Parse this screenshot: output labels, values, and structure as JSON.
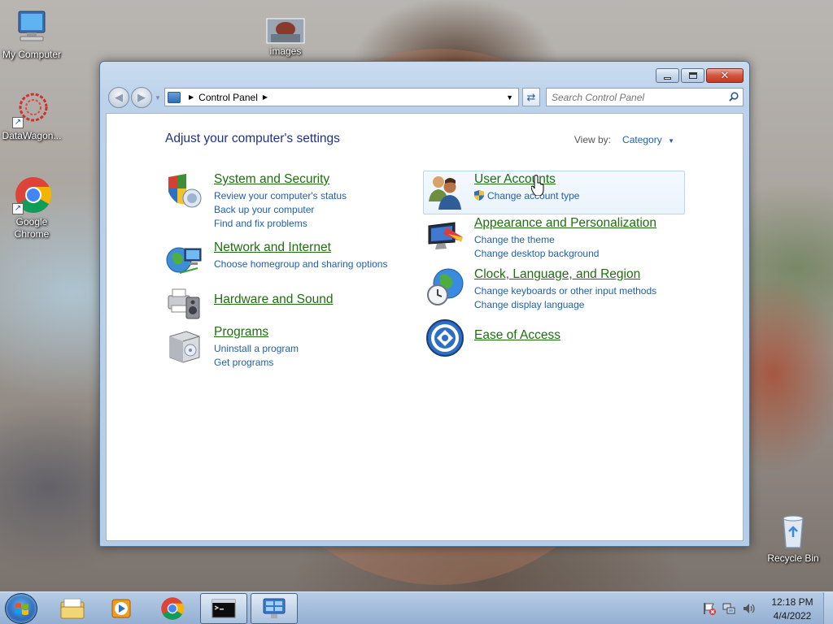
{
  "desktop": {
    "icons": [
      {
        "label": "My Computer",
        "icon": "computer-icon"
      },
      {
        "label": "images",
        "icon": "image-file-icon"
      },
      {
        "label": "DataWagon...",
        "icon": "datawagon-icon"
      },
      {
        "label": "Google Chrome",
        "icon": "chrome-icon"
      },
      {
        "label": "Recycle Bin",
        "icon": "recycle-bin-icon"
      }
    ]
  },
  "window": {
    "address": {
      "crumb": "Control Panel"
    },
    "search": {
      "placeholder": "Search Control Panel"
    },
    "heading": "Adjust your computer's settings",
    "view_by": {
      "label": "View by:",
      "value": "Category"
    },
    "categories": [
      {
        "title": "System and Security",
        "links": [
          "Review your computer's status",
          "Back up your computer",
          "Find and fix problems"
        ]
      },
      {
        "title": "Network and Internet",
        "links": [
          "Choose homegroup and sharing options"
        ]
      },
      {
        "title": "Hardware and Sound",
        "links": []
      },
      {
        "title": "Programs",
        "links": [
          "Uninstall a program",
          "Get programs"
        ]
      },
      {
        "title": "User Accounts",
        "links": [
          "Change account type"
        ]
      },
      {
        "title": "Appearance and Personalization",
        "links": [
          "Change the theme",
          "Change desktop background"
        ]
      },
      {
        "title": "Clock, Language, and Region",
        "links": [
          "Change keyboards or other input methods",
          "Change display language"
        ]
      },
      {
        "title": "Ease of Access",
        "links": []
      }
    ]
  },
  "taskbar": {
    "clock": {
      "time": "12:18 PM",
      "date": "4/4/2022"
    },
    "pinned": [
      "file-explorer-icon",
      "media-player-icon",
      "chrome-icon",
      "command-prompt-icon",
      "control-panel-icon"
    ]
  }
}
